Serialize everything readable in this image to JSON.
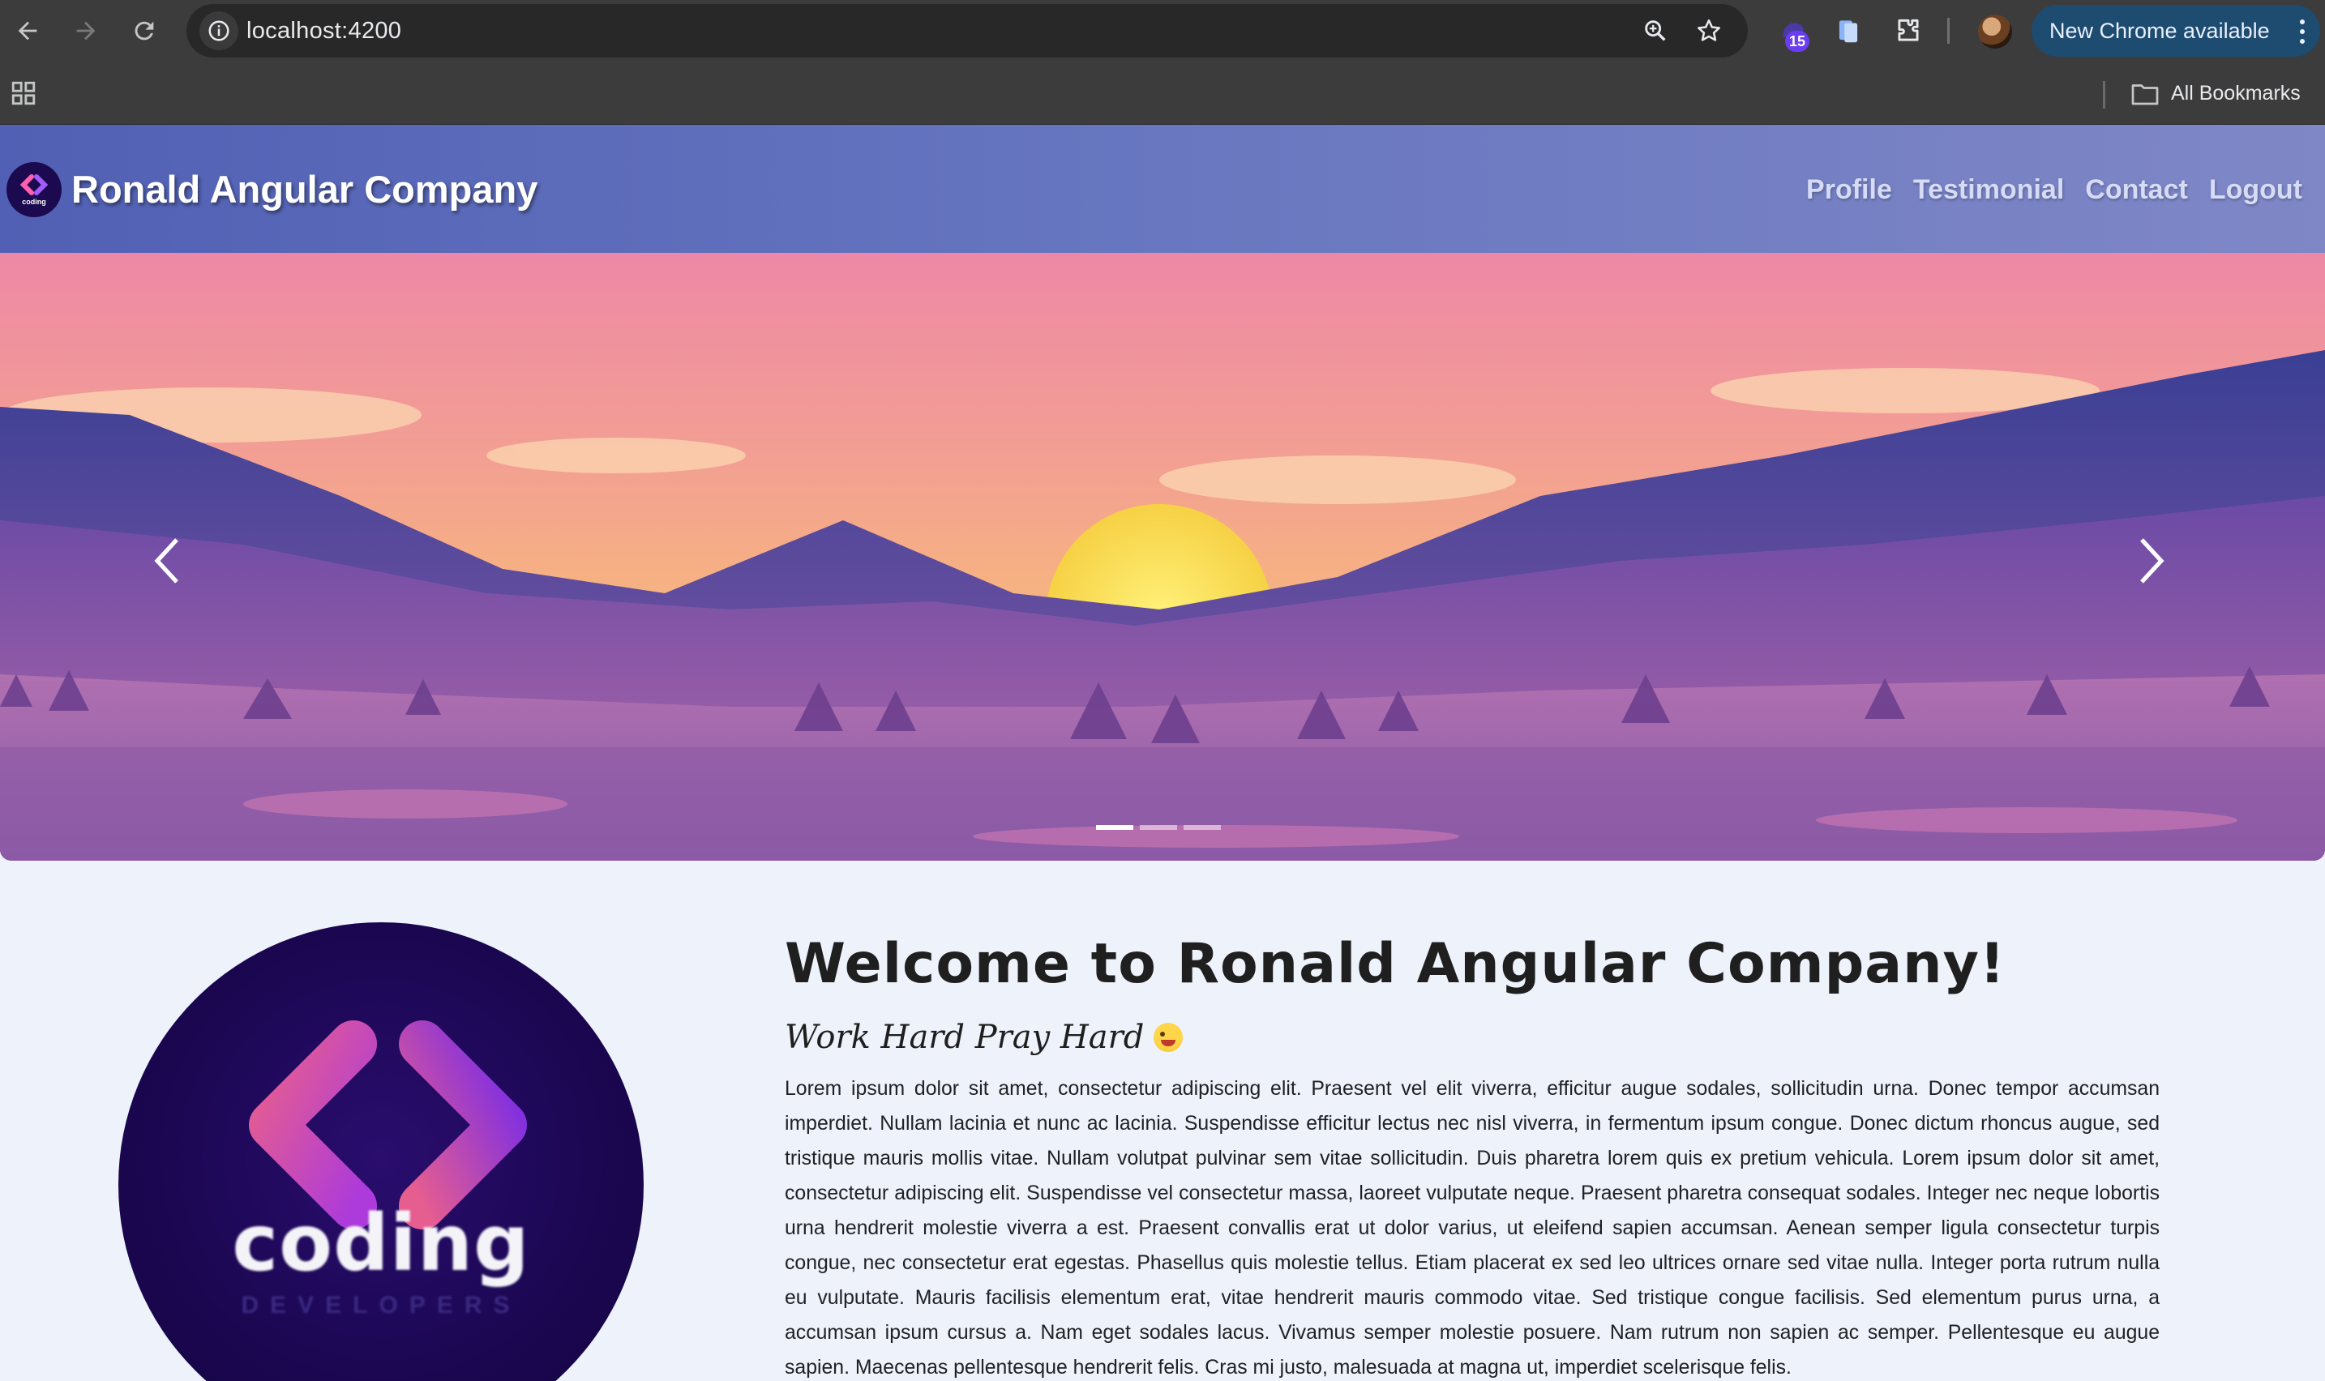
{
  "browser": {
    "url": "localhost:4200",
    "extension_badge": "15",
    "update_button": "New Chrome available",
    "bookmarks_label": "All Bookmarks",
    "icons": [
      "back-icon",
      "forward-icon",
      "reload-icon",
      "site-info-icon",
      "zoom-icon",
      "star-icon",
      "extension-icon",
      "extensions-puzzle-icon",
      "apps-grid-icon",
      "folder-icon"
    ]
  },
  "navbar": {
    "brand": "Ronald Angular Company",
    "brand_logo_text": "coding",
    "links": [
      "Profile",
      "Testimonial",
      "Contact",
      "Logout"
    ],
    "colors": {
      "gradient_start": "#5160b4",
      "gradient_end": "#7f87c6"
    }
  },
  "carousel": {
    "slide_count": 3,
    "active_index": 0,
    "prev_label": "Previous",
    "next_label": "Next"
  },
  "content": {
    "logo_word": "coding",
    "logo_subword": "DEVELOPERS",
    "welcome": "Welcome to Ronald Angular Company!",
    "tagline": "Work Hard Pray Hard",
    "paragraph": "Lorem ipsum dolor sit amet, consectetur adipiscing elit. Praesent vel elit viverra, efficitur augue sodales, sollicitudin urna. Donec tempor accumsan imperdiet. Nullam lacinia et nunc ac lacinia. Suspendisse efficitur lectus nec nisl viverra, in fermentum ipsum congue. Donec dictum rhoncus augue, sed tristique mauris mollis vitae. Nullam volutpat pulvinar sem vitae sollicitudin. Duis pharetra lorem quis ex pretium vehicula. Lorem ipsum dolor sit amet, consectetur adipiscing elit. Suspendisse vel consectetur massa, laoreet vulputate neque. Praesent pharetra consequat sodales. Integer nec neque lobortis urna hendrerit molestie viverra a est. Praesent convallis erat ut dolor varius, ut eleifend sapien accumsan. Aenean semper ligula consectetur turpis congue, nec consectetur erat egestas. Phasellus quis molestie tellus. Etiam placerat ex sed leo ultrices ornare sed vitae nulla. Integer porta rutrum nulla eu vulputate. Mauris facilisis elementum erat, vitae hendrerit mauris commodo vitae. Sed tristique congue facilisis. Sed elementum purus urna, a accumsan ipsum cursus a. Nam eget sodales lacus. Vivamus semper molestie posuere. Nam rutrum non sapien ac semper. Pellentesque eu augue sapien. Maecenas pellentesque hendrerit felis. Cras mi justo, malesuada at magna ut, imperdiet scelerisque felis."
  }
}
